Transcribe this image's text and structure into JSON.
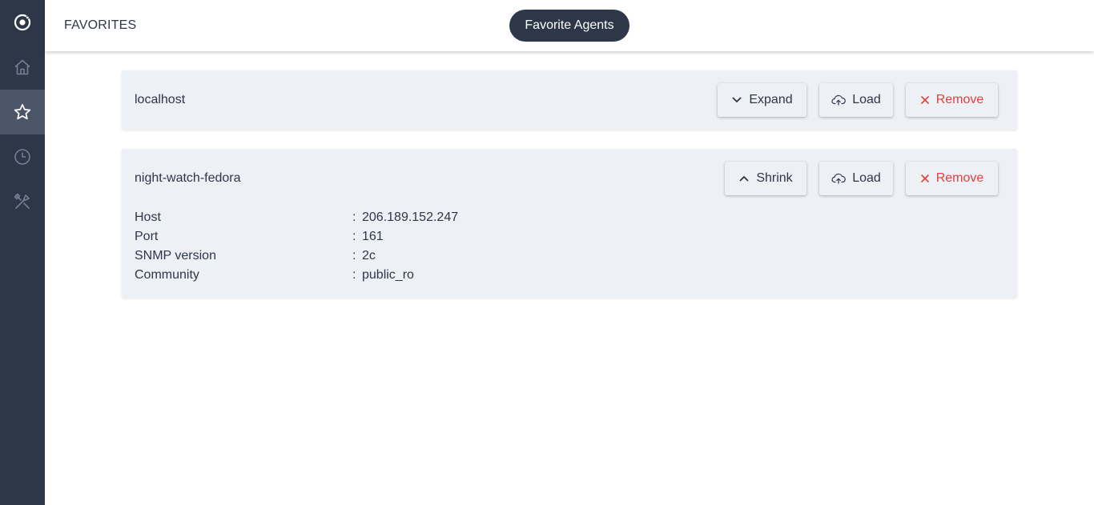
{
  "header": {
    "title": "FAVORITES",
    "pill": "Favorite Agents"
  },
  "sidebar": {
    "items": [
      {
        "icon": "logo-icon",
        "active": false
      },
      {
        "icon": "home-icon",
        "active": false
      },
      {
        "icon": "star-icon",
        "active": true
      },
      {
        "icon": "clock-icon",
        "active": false
      },
      {
        "icon": "tools-icon",
        "active": false
      }
    ]
  },
  "agents": [
    {
      "name": "localhost",
      "expanded": false,
      "toggle_label": "Expand",
      "load_label": "Load",
      "remove_label": "Remove"
    },
    {
      "name": "night-watch-fedora",
      "expanded": true,
      "toggle_label": "Shrink",
      "load_label": "Load",
      "remove_label": "Remove",
      "details": [
        {
          "key": "Host",
          "sep": ":",
          "value": "206.189.152.247"
        },
        {
          "key": "Port",
          "sep": ":",
          "value": "161"
        },
        {
          "key": "SNMP version",
          "sep": ":",
          "value": "2c"
        },
        {
          "key": "Community",
          "sep": ":",
          "value": "public_ro"
        }
      ]
    }
  ],
  "colors": {
    "sidebar": "#2d3748",
    "sidebar_active": "#4a5568",
    "card": "#edf0f4",
    "danger": "#e53e3e"
  }
}
